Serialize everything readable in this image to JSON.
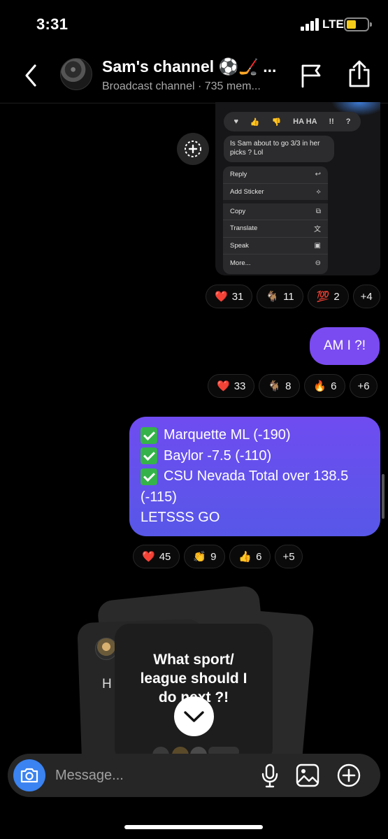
{
  "status_bar": {
    "time": "3:31",
    "network": "LTE"
  },
  "header": {
    "title": "Sam's channel ⚽️🏒 ...",
    "subtitle": "Broadcast channel · 735 mem..."
  },
  "embedded_screenshot": {
    "tapbacks": [
      "♥",
      "👍",
      "👎",
      "HA HA",
      "!!",
      "?"
    ],
    "quoted_message": "Is Sam about to go 3/3 in her picks ? Lol",
    "menu_items": [
      {
        "label": "Reply",
        "glyph": "↩"
      },
      {
        "label": "Add Sticker",
        "glyph": "⟡"
      },
      {
        "label": "Copy",
        "glyph": "⧉"
      },
      {
        "label": "Translate",
        "glyph": "文"
      },
      {
        "label": "Speak",
        "glyph": "▣"
      },
      {
        "label": "More...",
        "glyph": "⊖"
      }
    ]
  },
  "reactions_1": [
    {
      "emoji": "❤️",
      "count": "31"
    },
    {
      "emoji": "🐐",
      "count": "11"
    },
    {
      "emoji": "💯",
      "count": "2"
    },
    {
      "emoji": "",
      "count": "+4"
    }
  ],
  "message_1": {
    "text": "AM I ?!"
  },
  "reactions_2": [
    {
      "emoji": "❤️",
      "count": "33"
    },
    {
      "emoji": "🐐",
      "count": "8"
    },
    {
      "emoji": "🔥",
      "count": "6"
    },
    {
      "emoji": "",
      "count": "+6"
    }
  ],
  "message_2": {
    "lines": [
      "Marquette ML (-190)",
      "Baylor -7.5 (-110)",
      "CSU Nevada Total over 138.5",
      "(-115)",
      "LETSSS GO"
    ]
  },
  "reactions_3": [
    {
      "emoji": "❤️",
      "count": "45"
    },
    {
      "emoji": "👏",
      "count": "9"
    },
    {
      "emoji": "👍",
      "count": "6"
    },
    {
      "emoji": "",
      "count": "+5"
    }
  ],
  "poll_card": {
    "peek_text": "H",
    "question": "What sport/ league should I do next ?!"
  },
  "composer": {
    "placeholder": "Message..."
  },
  "colors": {
    "bubble_purple": "#7a4bf0",
    "bubble_gradient_bottom": "#5757e8",
    "camera_blue": "#3a83f1",
    "battery_yellow": "#f5cc1a"
  }
}
